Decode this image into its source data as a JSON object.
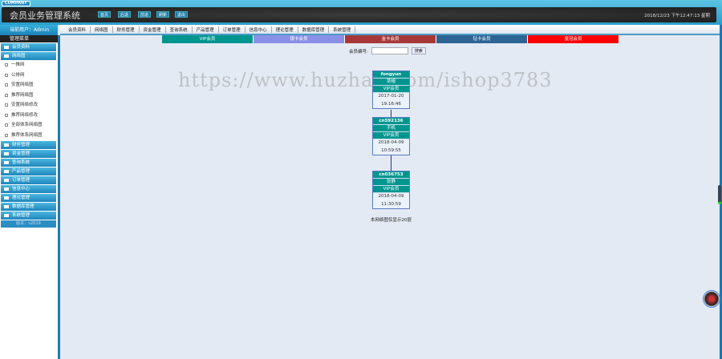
{
  "header": {
    "company": "COMPANY",
    "title": "会员业务管理系统",
    "buttons": [
      "首页",
      "后退",
      "前进",
      "刷新",
      "退出"
    ],
    "clock": "2018/12/23 下午12:47:13 星期"
  },
  "user": "当前用户：Admin",
  "nav": [
    "会员资料",
    "网络图",
    "财务管理",
    "资金管理",
    "查询系统",
    "产品管理",
    "订单管理",
    "信息中心",
    "理论管理",
    "数据库管理",
    "系统管理"
  ],
  "sidebar": {
    "title": "管理菜单",
    "groups_top": [
      "会员资料",
      "网络图"
    ],
    "sub": [
      "一推网",
      "公排网",
      "安置网络图",
      "推荐网络图",
      "安置网络修改",
      "推荐网络修改",
      "全部体系网络图",
      "推荐体系网络图"
    ],
    "groups": [
      "财务管理",
      "资金管理",
      "查询系统",
      "产品管理",
      "订单管理",
      "信息中心",
      "理论管理",
      "数据库管理",
      "系统管理"
    ],
    "version": "版本：v2019"
  },
  "tabs": [
    {
      "label": "VIP会员",
      "color": "#00968f"
    },
    {
      "label": "银卡会员",
      "color": "#8a90e8"
    },
    {
      "label": "金卡会员",
      "color": "#a83838"
    },
    {
      "label": "钻卡会员",
      "color": "#2e6494"
    },
    {
      "label": "皇冠会员",
      "color": "#ff0000"
    }
  ],
  "search": {
    "label": "会员编号:",
    "value": "",
    "button": "搜索"
  },
  "nodes": [
    {
      "id": "fongyun",
      "name": "草帽",
      "level": "VIP会员",
      "date": "2017-01-20",
      "time": "19:16:46"
    },
    {
      "id": "cn592136",
      "name": "手机",
      "level": "VIP会员",
      "date": "2018-04-09",
      "time": "10:59:55"
    },
    {
      "id": "cn036753",
      "name": "张静",
      "level": "VIP会员",
      "date": "2018-04-09",
      "time": "11:30:59"
    }
  ],
  "footer": "本网络图仅显示20层",
  "watermark": "https://www.huzhan.com/ishop3783"
}
